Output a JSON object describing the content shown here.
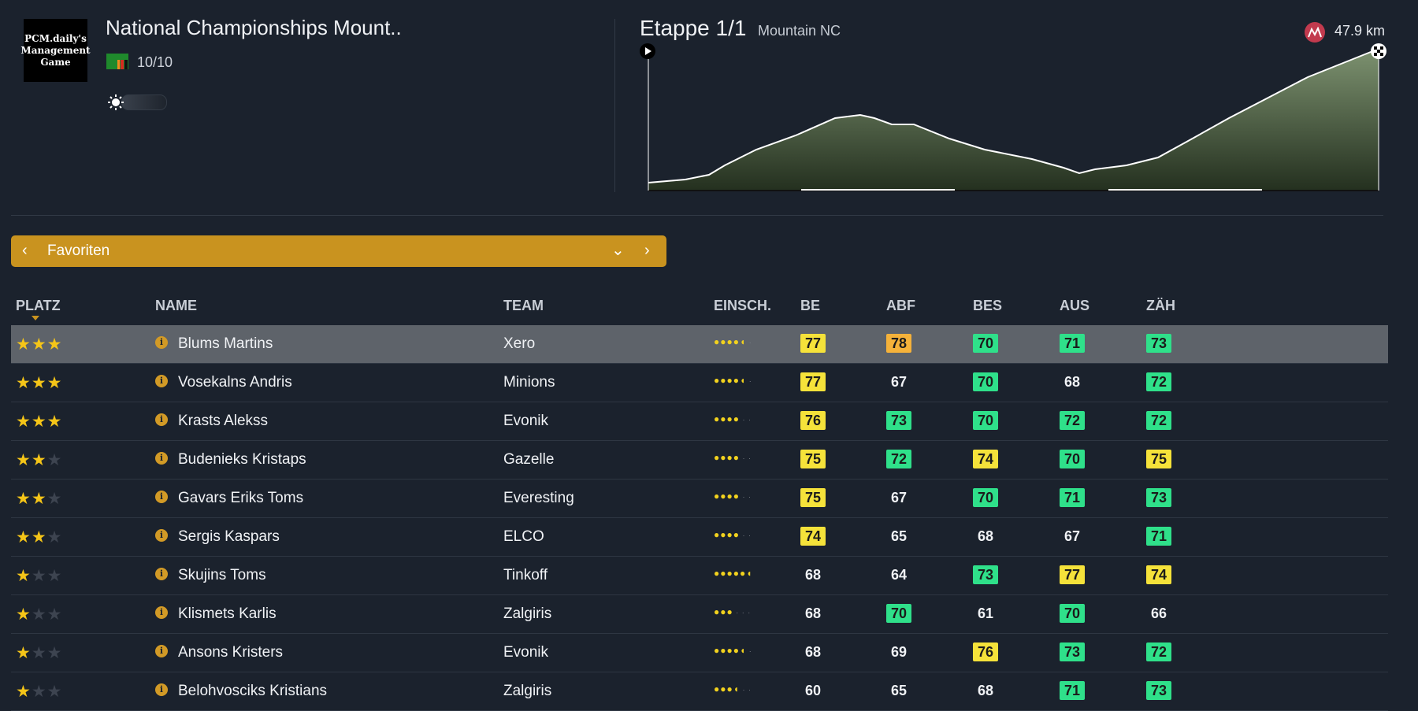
{
  "header": {
    "logo_lines": [
      "PCM.daily's",
      "Management",
      "Game"
    ],
    "race_title": "National Championships Mount..",
    "rating": "10/10",
    "flag_icon": "latvia-flag-icon",
    "weather_icon": "sun-icon"
  },
  "stage": {
    "title": "Etappe 1/1",
    "type": "Mountain NC",
    "distance": "47.9 km",
    "start_icon": "play-icon",
    "finish_icon": "checkered-flag-icon",
    "distance_icon": "mountain-icon"
  },
  "selector": {
    "label": "Favoriten",
    "prev_icon": "chevron-left-icon",
    "dropdown_icon": "chevron-down-icon",
    "next_icon": "chevron-right-icon"
  },
  "columns": {
    "platz": "PLATZ",
    "name": "NAME",
    "team": "TEAM",
    "einsch": "EINSCH.",
    "be": "BE",
    "abf": "ABF",
    "bes": "BES",
    "aus": "AUS",
    "zah": "ZÄH"
  },
  "colors": {
    "accent": "#c9931f",
    "stat_yellow": "#f5e23a",
    "stat_orange": "#f5b23a",
    "stat_green": "#2fe08a",
    "background": "#1b222d"
  },
  "rows": [
    {
      "stars": 3,
      "name": "Blums Martins",
      "team": "Xero",
      "form": 4.5,
      "be": "77",
      "be_c": "y",
      "abf": "78",
      "abf_c": "o",
      "bes": "70",
      "bes_c": "g",
      "aus": "71",
      "aus_c": "g",
      "zah": "73",
      "zah_c": "g",
      "selected": true
    },
    {
      "stars": 3,
      "name": "Vosekalns Andris",
      "team": "Minions",
      "form": 4.5,
      "be": "77",
      "be_c": "y",
      "abf": "67",
      "abf_c": "n",
      "bes": "70",
      "bes_c": "g",
      "aus": "68",
      "aus_c": "n",
      "zah": "72",
      "zah_c": "g"
    },
    {
      "stars": 3,
      "name": "Krasts Alekss",
      "team": "Evonik",
      "form": 4,
      "be": "76",
      "be_c": "y",
      "abf": "73",
      "abf_c": "g",
      "bes": "70",
      "bes_c": "g",
      "aus": "72",
      "aus_c": "g",
      "zah": "72",
      "zah_c": "g"
    },
    {
      "stars": 2,
      "name": "Budenieks Kristaps",
      "team": "Gazelle",
      "form": 4,
      "be": "75",
      "be_c": "y",
      "abf": "72",
      "abf_c": "g",
      "bes": "74",
      "bes_c": "y",
      "aus": "70",
      "aus_c": "g",
      "zah": "75",
      "zah_c": "y"
    },
    {
      "stars": 2,
      "name": "Gavars Eriks Toms",
      "team": "Everesting",
      "form": 4,
      "be": "75",
      "be_c": "y",
      "abf": "67",
      "abf_c": "n",
      "bes": "70",
      "bes_c": "g",
      "aus": "71",
      "aus_c": "g",
      "zah": "73",
      "zah_c": "g"
    },
    {
      "stars": 2,
      "name": "Sergis Kaspars",
      "team": "ELCO",
      "form": 4,
      "be": "74",
      "be_c": "y",
      "abf": "65",
      "abf_c": "n",
      "bes": "68",
      "bes_c": "n",
      "aus": "67",
      "aus_c": "n",
      "zah": "71",
      "zah_c": "g"
    },
    {
      "stars": 1,
      "name": "Skujins Toms",
      "team": "Tinkoff",
      "form": 5.5,
      "be": "68",
      "be_c": "n",
      "abf": "64",
      "abf_c": "n",
      "bes": "73",
      "bes_c": "g",
      "aus": "77",
      "aus_c": "y",
      "zah": "74",
      "zah_c": "y"
    },
    {
      "stars": 1,
      "name": "Klismets Karlis",
      "team": "Zalgiris",
      "form": 3,
      "be": "68",
      "be_c": "n",
      "abf": "70",
      "abf_c": "g",
      "bes": "61",
      "bes_c": "n",
      "aus": "70",
      "aus_c": "g",
      "zah": "66",
      "zah_c": "n"
    },
    {
      "stars": 1,
      "name": "Ansons Kristers",
      "team": "Evonik",
      "form": 4.5,
      "be": "68",
      "be_c": "n",
      "abf": "69",
      "abf_c": "n",
      "bes": "76",
      "bes_c": "y",
      "aus": "73",
      "aus_c": "g",
      "zah": "72",
      "zah_c": "g"
    },
    {
      "stars": 1,
      "name": "Belohvosciks Kristians",
      "team": "Zalgiris",
      "form": 3.5,
      "be": "60",
      "be_c": "n",
      "abf": "65",
      "abf_c": "n",
      "bes": "68",
      "bes_c": "n",
      "aus": "71",
      "aus_c": "g",
      "zah": "73",
      "zah_c": "g"
    }
  ]
}
